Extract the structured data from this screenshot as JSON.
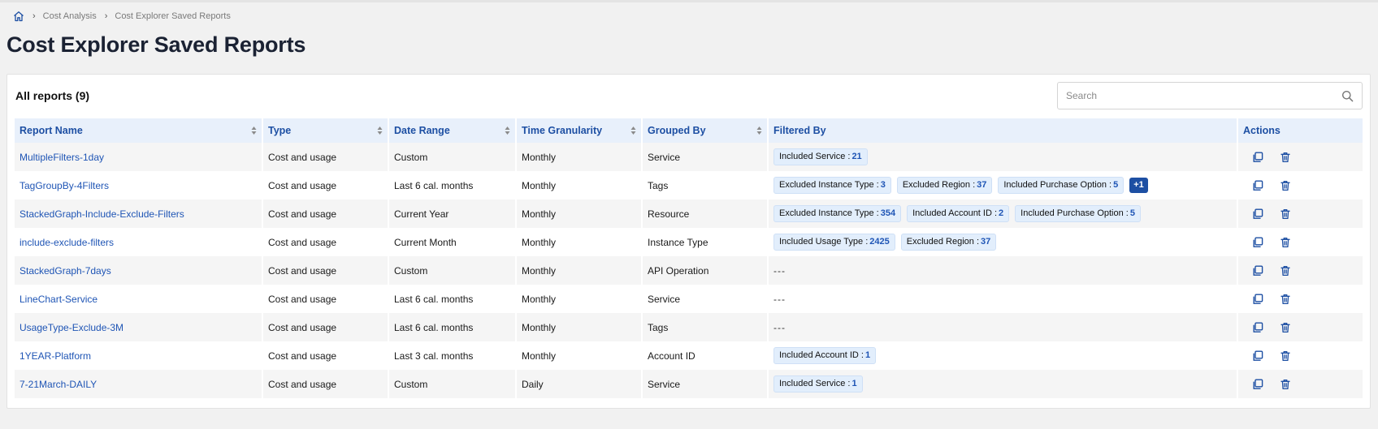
{
  "breadcrumb": {
    "items": [
      "Cost Analysis",
      "Cost Explorer Saved Reports"
    ]
  },
  "page": {
    "title": "Cost Explorer Saved Reports"
  },
  "reports": {
    "title": "All reports (9)",
    "search": {
      "placeholder": "Search",
      "value": ""
    },
    "columns": [
      "Report Name",
      "Type",
      "Date Range",
      "Time Granularity",
      "Grouped By",
      "Filtered By",
      "Actions"
    ],
    "rows": [
      {
        "name": "MultipleFilters-1day",
        "type": "Cost and usage",
        "range": "Custom",
        "granularity": "Monthly",
        "grouped": "Service",
        "filters": [
          {
            "label": "Included Service :",
            "count": "21"
          }
        ],
        "more": "",
        "empty": ""
      },
      {
        "name": "TagGroupBy-4Filters",
        "type": "Cost and usage",
        "range": "Last 6 cal. months",
        "granularity": "Monthly",
        "grouped": "Tags",
        "filters": [
          {
            "label": "Excluded Instance Type :",
            "count": "3"
          },
          {
            "label": "Excluded Region :",
            "count": "37"
          },
          {
            "label": "Included Purchase Option :",
            "count": "5"
          }
        ],
        "more": "+1",
        "empty": ""
      },
      {
        "name": "StackedGraph-Include-Exclude-Filters",
        "type": "Cost and usage",
        "range": "Current Year",
        "granularity": "Monthly",
        "grouped": "Resource",
        "filters": [
          {
            "label": "Excluded Instance Type :",
            "count": "354"
          },
          {
            "label": "Included Account ID :",
            "count": "2"
          },
          {
            "label": "Included Purchase Option :",
            "count": "5"
          }
        ],
        "more": "",
        "empty": ""
      },
      {
        "name": "include-exclude-filters",
        "type": "Cost and usage",
        "range": "Current Month",
        "granularity": "Monthly",
        "grouped": "Instance Type",
        "filters": [
          {
            "label": "Included Usage Type :",
            "count": "2425"
          },
          {
            "label": "Excluded Region :",
            "count": "37"
          }
        ],
        "more": "",
        "empty": ""
      },
      {
        "name": "StackedGraph-7days",
        "type": "Cost and usage",
        "range": "Custom",
        "granularity": "Monthly",
        "grouped": "API Operation",
        "filters": [],
        "more": "",
        "empty": "---"
      },
      {
        "name": "LineChart-Service",
        "type": "Cost and usage",
        "range": "Last 6 cal. months",
        "granularity": "Monthly",
        "grouped": "Service",
        "filters": [],
        "more": "",
        "empty": "---"
      },
      {
        "name": "UsageType-Exclude-3M",
        "type": "Cost and usage",
        "range": "Last 6 cal. months",
        "granularity": "Monthly",
        "grouped": "Tags",
        "filters": [],
        "more": "",
        "empty": "---"
      },
      {
        "name": "1YEAR-Platform",
        "type": "Cost and usage",
        "range": "Last 3 cal. months",
        "granularity": "Monthly",
        "grouped": "Account ID",
        "filters": [
          {
            "label": "Included Account ID :",
            "count": "1"
          }
        ],
        "more": "",
        "empty": ""
      },
      {
        "name": "7-21March-DAILY",
        "type": "Cost and usage",
        "range": "Custom",
        "granularity": "Daily",
        "grouped": "Service",
        "filters": [
          {
            "label": "Included Service :",
            "count": "1"
          }
        ],
        "more": "",
        "empty": ""
      }
    ]
  },
  "icons": {
    "home": "home-icon",
    "search": "search-icon",
    "duplicate": "duplicate-icon",
    "delete": "trash-icon",
    "sort": "sort-icon"
  },
  "colors": {
    "accent": "#1d4fa3",
    "link": "#1f55b5",
    "header_bg": "#e8f0fb",
    "tag_bg": "#e2eefc"
  }
}
